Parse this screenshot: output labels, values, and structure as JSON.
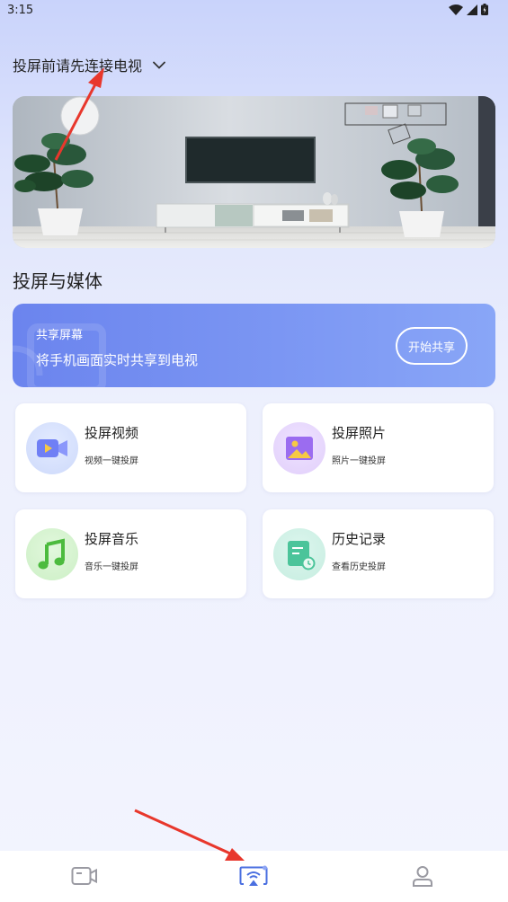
{
  "status_bar": {
    "time": "3:15"
  },
  "header": {
    "connect_text": "投屏前请先连接电视"
  },
  "section": {
    "title": "投屏与媒体"
  },
  "share_card": {
    "title": "共享屏幕",
    "description": "将手机画面实时共享到电视",
    "button_label": "开始共享"
  },
  "tiles": [
    {
      "title": "投屏视频",
      "subtitle": "视频一键投屏",
      "icon": "video-icon"
    },
    {
      "title": "投屏照片",
      "subtitle": "照片一键投屏",
      "icon": "photo-icon"
    },
    {
      "title": "投屏音乐",
      "subtitle": "音乐一键投屏",
      "icon": "music-icon"
    },
    {
      "title": "历史记录",
      "subtitle": "查看历史投屏",
      "icon": "history-icon"
    }
  ],
  "bottom_nav": [
    {
      "icon": "video-camera-icon",
      "active": false
    },
    {
      "icon": "screen-cast-icon",
      "active": true
    },
    {
      "icon": "user-icon",
      "active": false
    }
  ],
  "colors": {
    "accent": "#4a6fe0",
    "card_gradient_start": "#6b84ee",
    "card_gradient_end": "#89a6f7"
  }
}
